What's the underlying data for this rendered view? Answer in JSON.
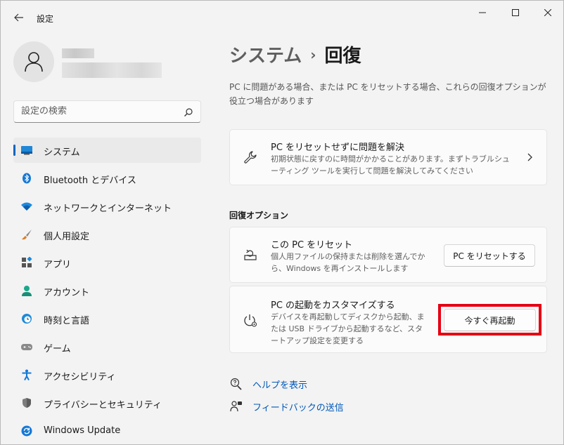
{
  "window": {
    "title": "設定",
    "colors": {
      "accent": "#0067c0",
      "link": "#0058b8",
      "highlight": "#e50012"
    }
  },
  "search": {
    "placeholder": "設定の検索"
  },
  "sidebar": {
    "items": [
      {
        "label": "システム",
        "icon": "system-icon",
        "active": true
      },
      {
        "label": "Bluetooth とデバイス",
        "icon": "bluetooth-icon"
      },
      {
        "label": "ネットワークとインターネット",
        "icon": "wifi-icon"
      },
      {
        "label": "個人用設定",
        "icon": "brush-icon"
      },
      {
        "label": "アプリ",
        "icon": "apps-icon"
      },
      {
        "label": "アカウント",
        "icon": "account-icon"
      },
      {
        "label": "時刻と言語",
        "icon": "time-language-icon"
      },
      {
        "label": "ゲーム",
        "icon": "gamepad-icon"
      },
      {
        "label": "アクセシビリティ",
        "icon": "accessibility-icon"
      },
      {
        "label": "プライバシーとセキュリティ",
        "icon": "shield-icon"
      },
      {
        "label": "Windows Update",
        "icon": "update-icon"
      }
    ]
  },
  "main": {
    "breadcrumb": {
      "parent": "システム",
      "separator": "›",
      "current": "回復"
    },
    "intro": "PC に問題がある場合、または PC をリセットする場合、これらの回復オプションが役立つ場合があります",
    "fix_card": {
      "title": "PC をリセットせずに問題を解決",
      "desc": "初期状態に戻すのに時間がかかることがあります。まずトラブルシューティング ツールを実行して問題を解決してみてください"
    },
    "section_label": "回復オプション",
    "reset_card": {
      "title": "この PC をリセット",
      "desc": "個人用ファイルの保持または削除を選んでから、Windows を再インストールします",
      "button": "PC をリセットする"
    },
    "startup_card": {
      "title": "PC の起動をカスタマイズする",
      "desc": "デバイスを再起動してディスクから起動、または USB ドライブから起動するなど、スタートアップ設定を変更する",
      "button": "今すぐ再起動"
    },
    "links": {
      "help": "ヘルプを表示",
      "feedback": "フィードバックの送信"
    }
  }
}
